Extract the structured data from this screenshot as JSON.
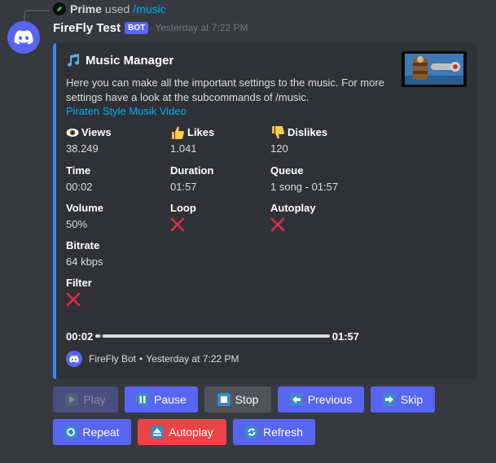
{
  "reply": {
    "user": "Prime",
    "verb": "used",
    "command": "/music"
  },
  "message": {
    "username": "FireFly Test",
    "bot_tag": "BOT",
    "timestamp": "Yesterday at 7:22 PM"
  },
  "embed": {
    "accent_color": "#2d8ef0",
    "title": "Music Manager",
    "title_icon": "music-note-icon",
    "description": "Here you can make all the important settings to the music. For more settings have a look at the subcommands of /music.",
    "link": "Piraten Style Musik Video",
    "fields": {
      "views": {
        "name": "Views",
        "icon": "eye-icon",
        "value": "38.249"
      },
      "likes": {
        "name": "Likes",
        "icon": "thumbs-up-icon",
        "value": "1.041"
      },
      "dislikes": {
        "name": "Dislikes",
        "icon": "thumbs-down-icon",
        "value": "120"
      },
      "time": {
        "name": "Time",
        "value": "00:02"
      },
      "duration": {
        "name": "Duration",
        "value": "01:57"
      },
      "queue": {
        "name": "Queue",
        "value": "1 song - 01:57"
      },
      "volume": {
        "name": "Volume",
        "value": "50%"
      },
      "loop": {
        "name": "Loop",
        "icon": "cross-mark-icon"
      },
      "autoplay": {
        "name": "Autoplay",
        "icon": "cross-mark-icon"
      },
      "bitrate": {
        "name": "Bitrate",
        "value": "64 kbps"
      },
      "filter": {
        "name": "Filter",
        "icon": "cross-mark-icon"
      }
    },
    "progress": {
      "current": "00:02",
      "total": "01:57",
      "fraction": 0.02
    },
    "footer": {
      "bot_name": "FireFly Bot",
      "separator": "•",
      "timestamp": "Yesterday at 7:22 PM"
    }
  },
  "buttons": {
    "play": "Play",
    "pause": "Pause",
    "stop": "Stop",
    "previous": "Previous",
    "skip": "Skip",
    "repeat": "Repeat",
    "autoplay": "Autoplay",
    "refresh": "Refresh"
  },
  "colors": {
    "background": "#36393f",
    "embed_bg": "#2f3136",
    "blurple": "#5865f2",
    "secondary": "#4f545c",
    "danger": "#ed4245",
    "link": "#00aff4",
    "cross": "#dd2e44"
  }
}
